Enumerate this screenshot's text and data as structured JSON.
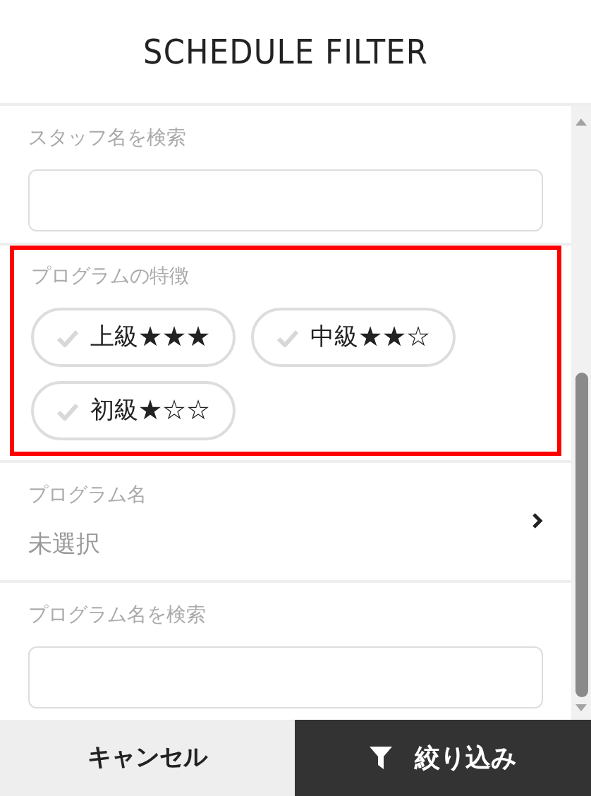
{
  "title": "SCHEDULE FILTER",
  "staff_search": {
    "label": "スタッフ名を検索"
  },
  "features": {
    "label": "プログラムの特徴",
    "highlighted": true,
    "chips": [
      {
        "label": "上級★★★",
        "selected": false
      },
      {
        "label": "中級★★☆",
        "selected": false
      },
      {
        "label": "初級★☆☆",
        "selected": false
      }
    ]
  },
  "program_name": {
    "label": "プログラム名",
    "value": "未選択"
  },
  "program_search": {
    "label": "プログラム名を検索"
  },
  "buttons": {
    "cancel": "キャンセル",
    "apply": "絞り込み"
  }
}
